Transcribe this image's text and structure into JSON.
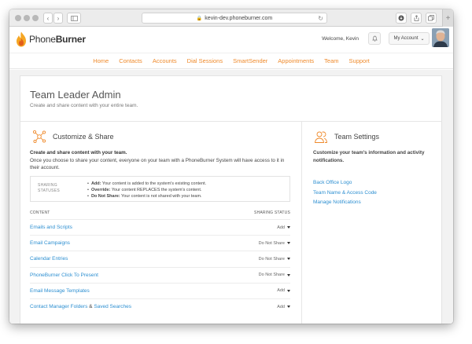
{
  "browser": {
    "url": "kevin-dev.phoneburner.com"
  },
  "header": {
    "brand_light": "Phone",
    "brand_bold": "Burner",
    "welcome": "Welcome, Kevin",
    "account_label": "My Account"
  },
  "nav": {
    "items": [
      "Home",
      "Contacts",
      "Accounts",
      "Dial Sessions",
      "SmartSender",
      "Appointments",
      "Team",
      "Support"
    ]
  },
  "page": {
    "title": "Team Leader Admin",
    "subtitle": "Create and share content with your entire team."
  },
  "customize": {
    "heading": "Customize & Share",
    "lead_bold": "Create and share content with your team.",
    "lead_text": "Once you choose to share your content, everyone on your team with a PhoneBurner System will have access to it in their account.",
    "status_label_1": "SHARING",
    "status_label_2": "STATUSES",
    "statuses": [
      {
        "term": "Add:",
        "desc": "Your content is added to the system's existing content."
      },
      {
        "term": "Override:",
        "desc": "Your content REPLACES the system's content."
      },
      {
        "term": "Do Not Share:",
        "desc": "Your content is not shared with your team."
      }
    ],
    "col_content": "CONTENT",
    "col_status": "SHARING STATUS",
    "rows": [
      {
        "name": "Emails and Scripts",
        "status": "Add"
      },
      {
        "name": "Email Campaigns",
        "status": "Do Not Share"
      },
      {
        "name": "Calendar Entries",
        "status": "Do Not Share"
      },
      {
        "name": "PhoneBurner Click To Present",
        "status": "Do Not Share"
      },
      {
        "name": "Email Message Templates",
        "status": "Add"
      },
      {
        "name_a": "Contact Manager Folders",
        "amp": "&",
        "name_b": "Saved Searches",
        "status": "Add"
      }
    ]
  },
  "team_settings": {
    "heading": "Team Settings",
    "description": "Customize your team's information and activity notifications.",
    "links": [
      "Back Office Logo",
      "Team Name & Access Code",
      "Manage Notifications"
    ]
  },
  "colors": {
    "accent": "#ef8a2b",
    "link": "#2d8fd1"
  }
}
